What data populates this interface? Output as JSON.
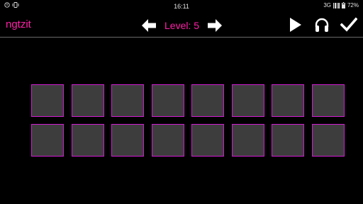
{
  "status_bar": {
    "time": "16:11",
    "network": "3G",
    "battery": "72%",
    "battery_level": 0.72,
    "left_icons": [
      "notification-icon",
      "vibrate-icon"
    ]
  },
  "app": {
    "title": "ngtzit",
    "level_label": "Level: 5",
    "accent_color": "#ff1fa8",
    "nav_icons": [
      "arrow-left-icon",
      "arrow-right-icon"
    ],
    "action_icons": [
      "play-icon",
      "headphones-icon",
      "checkmark-icon"
    ]
  },
  "grid": {
    "rows": 2,
    "columns": 8,
    "cell_color": "#3d3d3d",
    "cell_border_color": "#d21ad2"
  }
}
